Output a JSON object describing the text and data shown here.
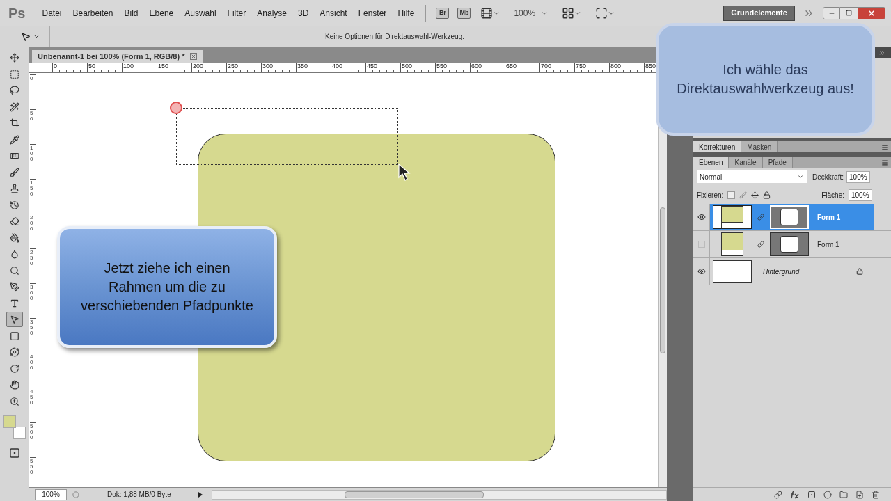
{
  "menu_bar": {
    "logo": "Ps",
    "items": [
      "Datei",
      "Bearbeiten",
      "Bild",
      "Ebene",
      "Auswahl",
      "Filter",
      "Analyse",
      "3D",
      "Ansicht",
      "Fenster",
      "Hilfe"
    ],
    "app_buttons": [
      "Br",
      "Mb"
    ],
    "zoom": "100%",
    "workspace": "Grundelemente"
  },
  "options_bar": {
    "message": "Keine Optionen für Direktauswahl-Werkzeug."
  },
  "tools": [
    {
      "kind": "move",
      "selected": false
    },
    {
      "kind": "marquee",
      "selected": false
    },
    {
      "kind": "lasso",
      "selected": false
    },
    {
      "kind": "wand",
      "selected": false
    },
    {
      "kind": "crop",
      "selected": false
    },
    {
      "kind": "eyedropper",
      "selected": false
    },
    {
      "kind": "healing",
      "selected": false
    },
    {
      "kind": "brush",
      "selected": false
    },
    {
      "kind": "stamp",
      "selected": false
    },
    {
      "kind": "history",
      "selected": false
    },
    {
      "kind": "eraser",
      "selected": false
    },
    {
      "kind": "bucket",
      "selected": false
    },
    {
      "kind": "blur",
      "selected": false
    },
    {
      "kind": "dodge",
      "selected": false
    },
    {
      "kind": "pen",
      "selected": false
    },
    {
      "kind": "type",
      "selected": false
    },
    {
      "kind": "direct",
      "selected": true
    },
    {
      "kind": "shape",
      "selected": false
    },
    {
      "kind": "orbit",
      "selected": false
    },
    {
      "kind": "rotate",
      "selected": false
    },
    {
      "kind": "hand",
      "selected": false
    },
    {
      "kind": "zoom",
      "selected": false
    }
  ],
  "document": {
    "tab_title": "Unbenannt-1 bei 100% (Form 1, RGB/8) *",
    "horizontal_ruler": [
      "0",
      "50",
      "100",
      "150",
      "200",
      "250",
      "300",
      "350",
      "400",
      "450",
      "500",
      "550",
      "600",
      "650",
      "700",
      "750",
      "800",
      "850"
    ],
    "vertical_ruler": [
      "0",
      "50",
      "100",
      "150",
      "200",
      "250",
      "300",
      "350",
      "400",
      "450",
      "500",
      "550"
    ],
    "callout": "Jetzt ziehe ich einen Rahmen um die zu verschiebenden Pfadpunkte"
  },
  "status_bar": {
    "zoom": "100%",
    "info": "Dok: 1,88 MB/0 Byte"
  },
  "adjust_panel": {
    "tabs": [
      {
        "label": "Korrekturen",
        "selected": true
      },
      {
        "label": "Masken",
        "selected": false
      }
    ]
  },
  "layers_panel": {
    "tabs": [
      {
        "label": "Ebenen",
        "selected": true
      },
      {
        "label": "Kanäle",
        "selected": false
      },
      {
        "label": "Pfade",
        "selected": false
      }
    ],
    "blend_mode": "Normal",
    "opacity_label": "Deckkraft:",
    "opacity": "100%",
    "lock_label": "Fixieren:",
    "fill_label": "Fläche:",
    "fill": "100%",
    "layers": [
      {
        "kind": "shape",
        "name": "Form 1",
        "visible": true,
        "selected": true
      },
      {
        "kind": "shape",
        "name": "Form 1",
        "visible": false,
        "selected": false
      },
      {
        "kind": "background",
        "name": "Hintergrund",
        "visible": true,
        "selected": false
      }
    ]
  },
  "overlay_callout": "Ich wähle das Direktauswahlwerkzeug aus!"
}
